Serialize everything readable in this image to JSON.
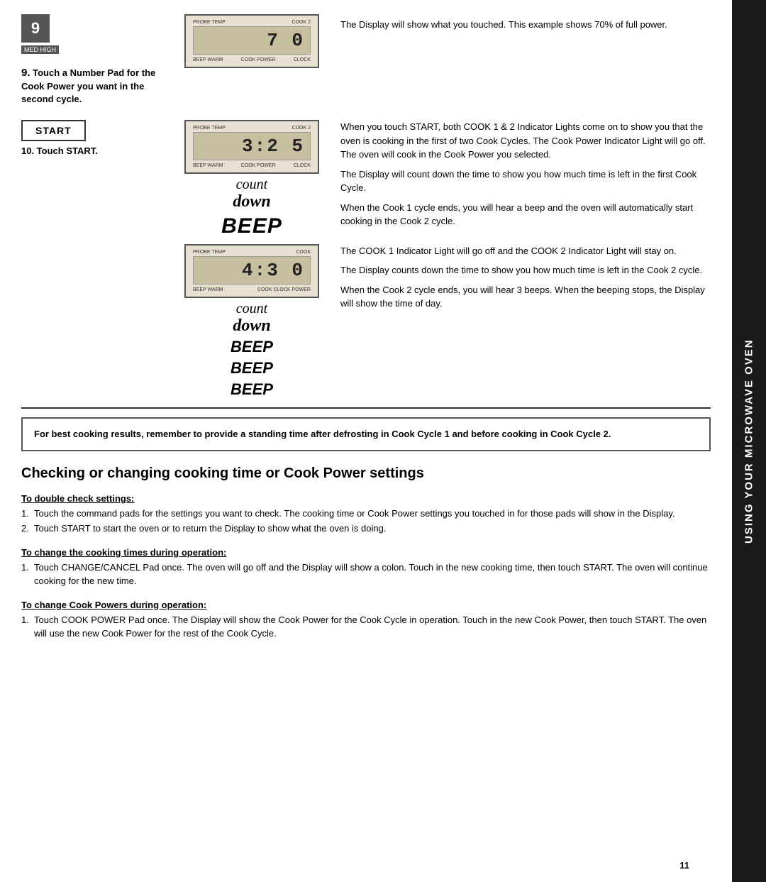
{
  "sidebar": {
    "text": "USING YOUR MICROWAVE OVEN"
  },
  "step9": {
    "num": "9",
    "badge_label": "MED HIGH",
    "label": "Touch a Number Pad for the Cook Power you want in the second cycle."
  },
  "step10": {
    "label": "10. Touch START."
  },
  "start_button": {
    "label": "START"
  },
  "display1": {
    "top_left": "PROBE TEMP",
    "top_right": "COOK 2",
    "screen": "7 0",
    "bottom_left": "BEEP WARM",
    "bottom_middle": "COOK POWER",
    "bottom_right": "CLOCK"
  },
  "display2": {
    "top_left": "PROBE TEMP",
    "top_right": "COOK 2",
    "screen": "3:2 5",
    "bottom_left": "BEEP WARM",
    "bottom_middle": "COOK POWER",
    "bottom_right": "CLOCK"
  },
  "display3": {
    "top_left": "PROBE TEMP",
    "top_right": "COOK",
    "screen": "4:3 0",
    "bottom_left": "BEEP WARM",
    "bottom_middle": "COOK CLOCK POWER"
  },
  "right_text1": "The Display will show what you touched. This example shows 70% of full power.",
  "right_text2": "When you touch START, both COOK 1 & 2 Indicator Lights come on to show you that the oven is cooking in the first of two Cook Cycles. The Cook Power Indicator Light will go off. The oven will cook in the Cook Power you selected.",
  "right_text3": "The Display will count down the time to show you how much time is left in the first Cook Cycle.",
  "right_text4": "When the Cook 1 cycle ends, you will hear a beep and the oven will automatically start cooking in the Cook 2 cycle.",
  "right_text5": "The COOK 1 Indicator Light will go off and the COOK 2 Indicator Light will stay on.",
  "right_text6": "The Display counts down the time to show you how much time is left in the Cook 2 cycle.",
  "right_text7": "When the Cook 2 cycle ends, you will hear 3 beeps. When the beeping stops, the Display will show the time of day.",
  "count_down": {
    "count": "count",
    "down": "down"
  },
  "beep1": "BEEP",
  "beep2": "BEEP",
  "beep3": "BEEP",
  "notice": {
    "text": "For best cooking results, remember to provide a standing time after defrosting in Cook Cycle 1 and before cooking in Cook Cycle 2."
  },
  "section_heading": "Checking or changing cooking time or Cook Power settings",
  "sub1": {
    "heading": "To double check settings:",
    "items": [
      "Touch the command pads for the settings you want to check. The cooking time or Cook Power settings you touched in for those pads will show in the Display.",
      "Touch START to start the oven or to return the Display to show what the oven is doing."
    ]
  },
  "sub2": {
    "heading": "To change the cooking times during operation:",
    "items": [
      "Touch CHANGE/CANCEL Pad once. The oven will go off and the Display will show a colon. Touch in the new cooking time, then touch START. The oven will continue cooking for the new time."
    ]
  },
  "sub3": {
    "heading": "To change Cook Powers during operation:",
    "items": [
      "Touch COOK POWER Pad once. The Display will show the Cook Power for the Cook Cycle in operation. Touch in the new Cook Power, then touch START. The oven will use the new Cook Power for the rest of the Cook Cycle."
    ]
  },
  "page_number": "11"
}
